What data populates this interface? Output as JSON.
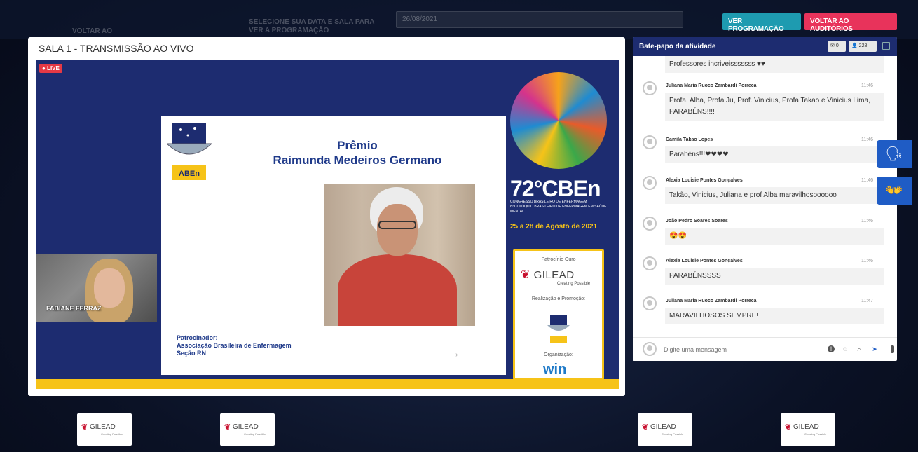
{
  "background": {
    "nav_left_text": "VOLTAR AO",
    "nav_mid_text": "SELECIONE SUA DATA E SALA PARA VER A PROGRAMAÇÃO",
    "select_value": "26/08/2021"
  },
  "top_buttons": {
    "programacao": "VER PROGRAMAÇÃO",
    "voltar": "VOLTAR AO AUDITÓRIOS"
  },
  "video": {
    "title": "SALA 1 - TRANSMISSÃO AO VIVO",
    "live_badge": "● LIVE",
    "slide_title_line1": "Prêmio",
    "slide_title_line2": "Raimunda Medeiros Germano",
    "slide_sponsor_line1": "Patrocinador:",
    "slide_sponsor_line2": "Associação Brasileira de Enfermagem",
    "slide_sponsor_line3": "Seção RN",
    "cben_title": "72°CBEn",
    "cben_sub1": "CONGRESSO BRASILEIRO DE ENFERMAGEM",
    "cben_sub2": "8º COLÓQUIO BRASILEIRO DE ENFERMAGEM EM SAÚDE MENTAL",
    "cben_date": "25 a 28 de Agosto de 2021",
    "sponsor_gold": "Patrocínio Ouro",
    "gilead": "GILEAD",
    "creating_possible": "Creating Possible",
    "realizacao": "Realização e Promoção:",
    "organizacao": "Organização:",
    "win": "win",
    "speaker_name": "FABIANE FERRAZ"
  },
  "chat": {
    "title": "Bate-papo da atividade",
    "msg_count": "0",
    "user_count": "228",
    "first_message": "Professores incriveisssssss ♥♥",
    "messages": [
      {
        "name": "Juliana Maria Ruoco Zambardi Porreca",
        "time": "11:46",
        "text": "Profa. Alba, Profa Ju, Prof. Vinicius, Profa Takao e Vinicius Lima, PARABÉNS!!!!"
      },
      {
        "name": "Camila Takao Lopes",
        "time": "11:46",
        "text": "Parabéns!!!❤❤❤❤"
      },
      {
        "name": "Alexia Louisie Pontes Gonçalves",
        "time": "11:46",
        "text": "Takão, Vinicius, Juliana e prof Alba maravilhosoooooo"
      },
      {
        "name": "João Pedro Soares Soares",
        "time": "11:46",
        "text": "😍😍"
      },
      {
        "name": "Alexia Louisie Pontes Gonçalves",
        "time": "11:46",
        "text": "PARABÉNSSSS"
      },
      {
        "name": "Juliana Maria Ruoco Zambardi Porreca",
        "time": "11:47",
        "text": "MARAVILHOSOS SEMPRE!"
      }
    ],
    "input_placeholder": "Digite uma mensagem"
  },
  "side_buttons": {
    "accessibility_audio": "audio-description-icon",
    "sign_language": "sign-language-icon"
  },
  "bottom_logos": [
    "GILEAD",
    "GILEAD",
    "GILEAD",
    "GILEAD"
  ],
  "bottom_logo_sub": "Creating Possible",
  "colors": {
    "brand_blue": "#1d2c70",
    "accent_yellow": "#f6c318",
    "btn_teal": "#1e9bb0",
    "btn_pink": "#e8335b",
    "gilead_red": "#c8102e"
  }
}
